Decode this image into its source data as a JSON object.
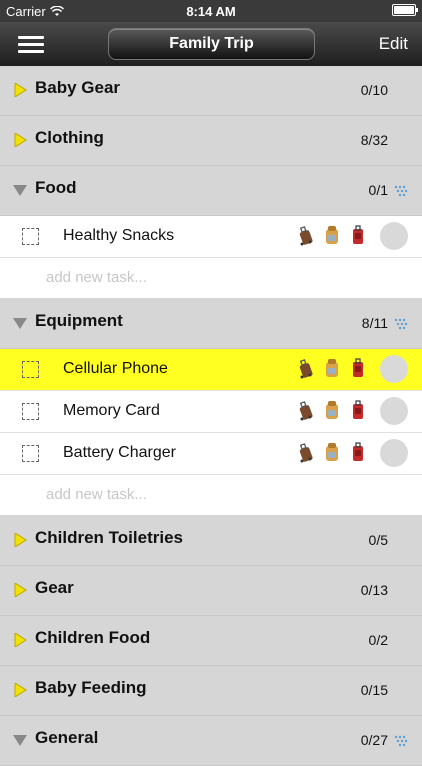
{
  "status": {
    "carrier": "Carrier",
    "time": "8:14 AM"
  },
  "nav": {
    "title": "Family Trip",
    "edit": "Edit"
  },
  "categories": [
    {
      "name": "Baby Gear",
      "count": "0/10",
      "expanded": false
    },
    {
      "name": "Clothing",
      "count": "8/32",
      "expanded": false
    },
    {
      "name": "Food",
      "count": "0/1",
      "expanded": true,
      "tasks": [
        {
          "name": "Healthy Snacks",
          "highlighted": false
        }
      ]
    },
    {
      "name": "Equipment",
      "count": "8/11",
      "expanded": true,
      "tasks": [
        {
          "name": "Cellular Phone",
          "highlighted": true
        },
        {
          "name": "Memory Card",
          "highlighted": false
        },
        {
          "name": "Battery Charger",
          "highlighted": false
        }
      ]
    },
    {
      "name": "Children Toiletries",
      "count": "0/5",
      "expanded": false
    },
    {
      "name": "Gear",
      "count": "0/13",
      "expanded": false
    },
    {
      "name": "Children Food",
      "count": "0/2",
      "expanded": false
    },
    {
      "name": "Baby Feeding",
      "count": "0/15",
      "expanded": false
    },
    {
      "name": "General",
      "count": "0/27",
      "expanded": true
    }
  ],
  "add_task_placeholder": "add new task...",
  "colors": {
    "highlight": "#ffff22",
    "arrow_collapsed": "#f2e200",
    "arrow_expanded": "#888888",
    "navbar": "#2b2b2b"
  }
}
